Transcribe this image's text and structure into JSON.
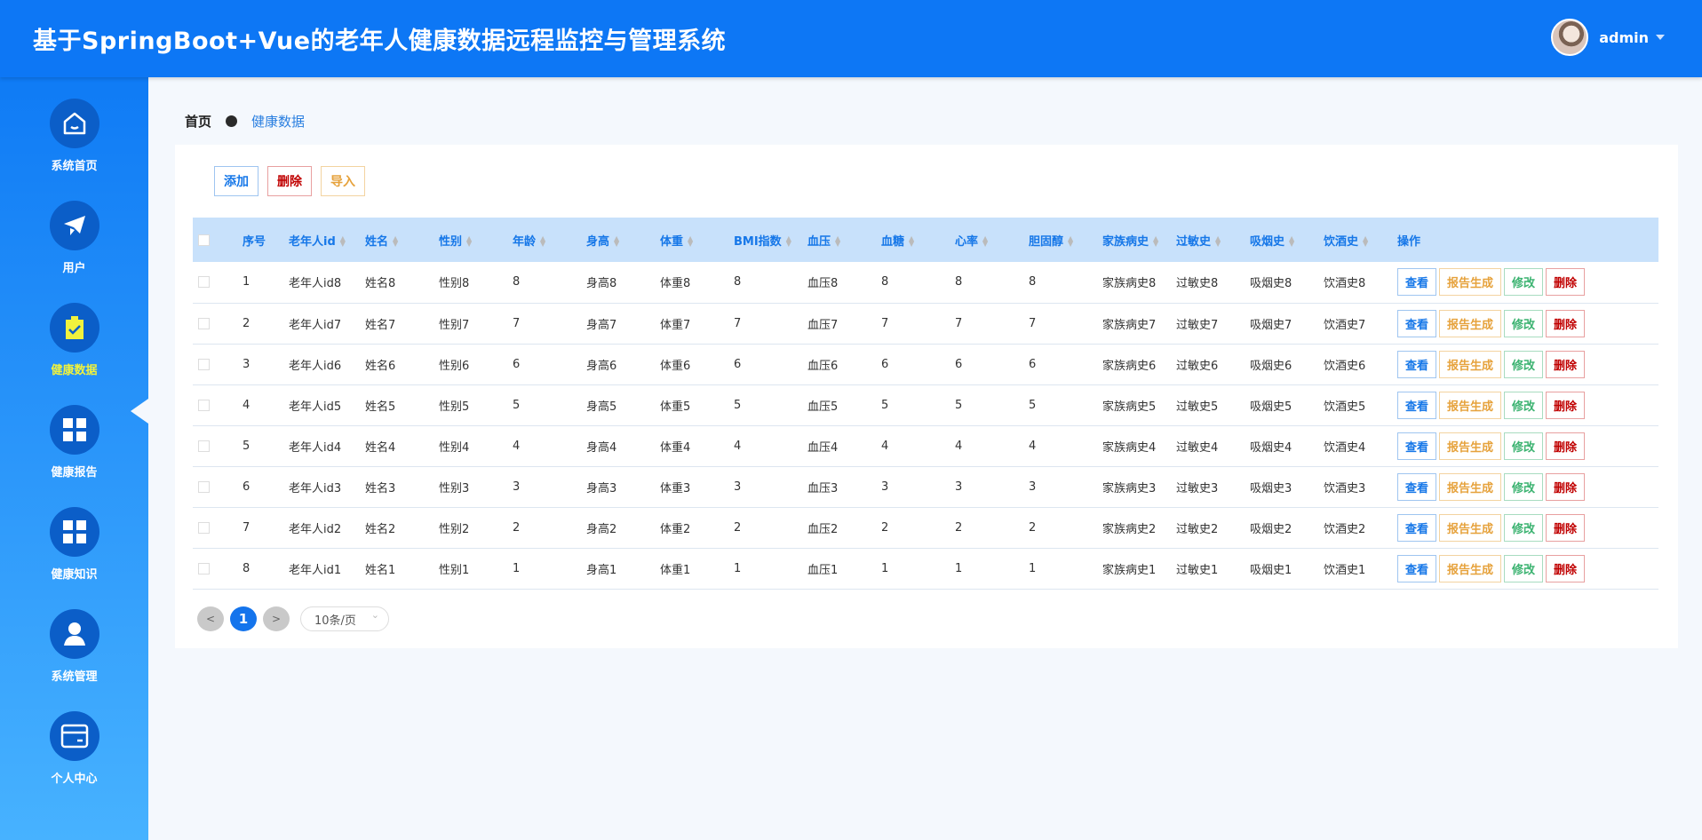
{
  "header": {
    "title": "基于SpringBoot+Vue的老年人健康数据远程监控与管理系统",
    "username": "admin"
  },
  "sidebar": {
    "items": [
      {
        "label": "系统首页",
        "icon": "home-icon"
      },
      {
        "label": "用户",
        "icon": "paper-plane-icon"
      },
      {
        "label": "健康数据",
        "icon": "clipboard-check-icon",
        "active": true
      },
      {
        "label": "健康报告",
        "icon": "grid-icon"
      },
      {
        "label": "健康知识",
        "icon": "grid-icon"
      },
      {
        "label": "系统管理",
        "icon": "user-icon"
      },
      {
        "label": "个人中心",
        "icon": "card-icon"
      }
    ]
  },
  "breadcrumb": {
    "home": "首页",
    "current": "健康数据"
  },
  "toolbar": {
    "add": "添加",
    "delete": "删除",
    "import": "导入"
  },
  "table": {
    "columns": [
      "序号",
      "老年人id",
      "姓名",
      "性别",
      "年龄",
      "身高",
      "体重",
      "BMI指数",
      "血压",
      "血糖",
      "心率",
      "胆固醇",
      "家族病史",
      "过敏史",
      "吸烟史",
      "饮酒史",
      "操作"
    ],
    "rows": [
      [
        "1",
        "老年人id8",
        "姓名8",
        "性别8",
        "8",
        "身高8",
        "体重8",
        "8",
        "血压8",
        "8",
        "8",
        "8",
        "家族病史8",
        "过敏史8",
        "吸烟史8",
        "饮酒史8"
      ],
      [
        "2",
        "老年人id7",
        "姓名7",
        "性别7",
        "7",
        "身高7",
        "体重7",
        "7",
        "血压7",
        "7",
        "7",
        "7",
        "家族病史7",
        "过敏史7",
        "吸烟史7",
        "饮酒史7"
      ],
      [
        "3",
        "老年人id6",
        "姓名6",
        "性别6",
        "6",
        "身高6",
        "体重6",
        "6",
        "血压6",
        "6",
        "6",
        "6",
        "家族病史6",
        "过敏史6",
        "吸烟史6",
        "饮酒史6"
      ],
      [
        "4",
        "老年人id5",
        "姓名5",
        "性别5",
        "5",
        "身高5",
        "体重5",
        "5",
        "血压5",
        "5",
        "5",
        "5",
        "家族病史5",
        "过敏史5",
        "吸烟史5",
        "饮酒史5"
      ],
      [
        "5",
        "老年人id4",
        "姓名4",
        "性别4",
        "4",
        "身高4",
        "体重4",
        "4",
        "血压4",
        "4",
        "4",
        "4",
        "家族病史4",
        "过敏史4",
        "吸烟史4",
        "饮酒史4"
      ],
      [
        "6",
        "老年人id3",
        "姓名3",
        "性别3",
        "3",
        "身高3",
        "体重3",
        "3",
        "血压3",
        "3",
        "3",
        "3",
        "家族病史3",
        "过敏史3",
        "吸烟史3",
        "饮酒史3"
      ],
      [
        "7",
        "老年人id2",
        "姓名2",
        "性别2",
        "2",
        "身高2",
        "体重2",
        "2",
        "血压2",
        "2",
        "2",
        "2",
        "家族病史2",
        "过敏史2",
        "吸烟史2",
        "饮酒史2"
      ],
      [
        "8",
        "老年人id1",
        "姓名1",
        "性别1",
        "1",
        "身高1",
        "体重1",
        "1",
        "血压1",
        "1",
        "1",
        "1",
        "家族病史1",
        "过敏史1",
        "吸烟史1",
        "饮酒史1"
      ]
    ],
    "actions": [
      "查看",
      "报告生成",
      "修改",
      "删除"
    ]
  },
  "pagination": {
    "prev": "<",
    "current": "1",
    "next": ">",
    "page_size": "10条/页"
  },
  "colors": {
    "header": "#0d77f5",
    "view": "#1677e8",
    "report": "#e6a23c",
    "edit": "#3cb371",
    "delete": "#c00000"
  }
}
